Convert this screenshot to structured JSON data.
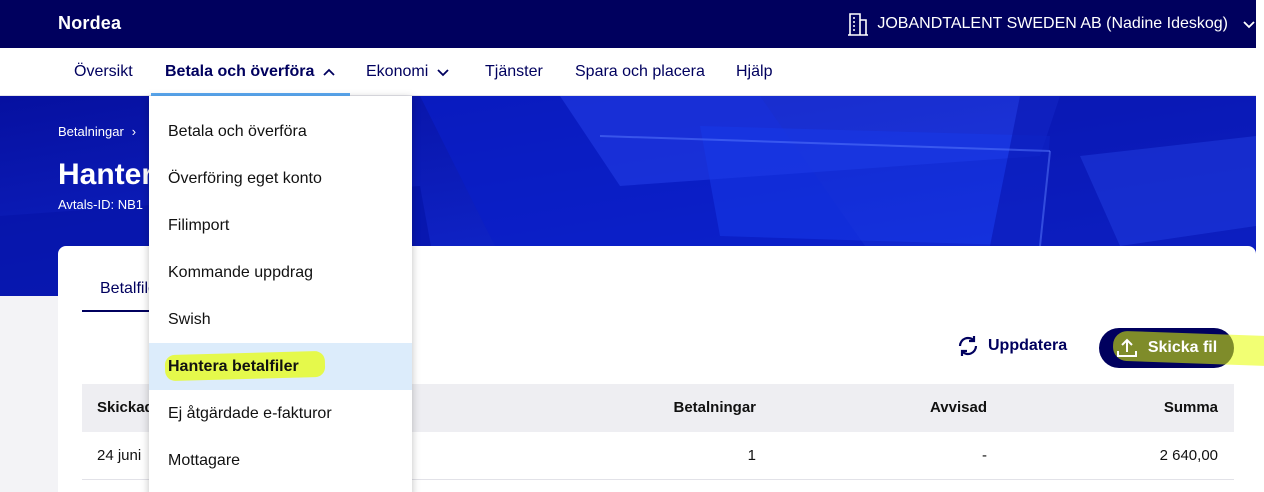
{
  "topbar": {
    "logo": "Nordea",
    "account": "JOBANDTALENT SWEDEN AB (Nadine Ideskog)"
  },
  "nav": {
    "items": [
      {
        "label": "Översikt"
      },
      {
        "label": "Betala och överföra"
      },
      {
        "label": "Ekonomi"
      },
      {
        "label": "Tjänster"
      },
      {
        "label": "Spara och placera"
      },
      {
        "label": "Hjälp"
      }
    ]
  },
  "hero": {
    "breadcrumb": "Betalningar",
    "title": "Hantera betalfiler",
    "avtal": "Avtals-ID: NB1"
  },
  "dropdown": {
    "items": [
      {
        "label": "Betala och överföra"
      },
      {
        "label": "Överföring eget konto"
      },
      {
        "label": "Filimport"
      },
      {
        "label": "Kommande uppdrag"
      },
      {
        "label": "Swish"
      },
      {
        "label": "Hantera betalfiler"
      },
      {
        "label": "Ej åtgärdade e-fakturor"
      },
      {
        "label": "Mottagare"
      }
    ],
    "selected_index": 5
  },
  "card": {
    "tab": "Betalfiler",
    "refresh_label": "Uppdatera",
    "send_label": "Skicka fil",
    "table": {
      "headers": [
        "Skickad",
        "Betalningar",
        "Avvisad",
        "Summa"
      ],
      "rows": [
        [
          "24 juni",
          "1",
          "-",
          "2 640,00"
        ]
      ]
    }
  },
  "colors": {
    "navy": "#00005e",
    "hero_blue": "#0a17b8",
    "accent": "#5aa9f2",
    "highlight": "#e8ff00"
  }
}
